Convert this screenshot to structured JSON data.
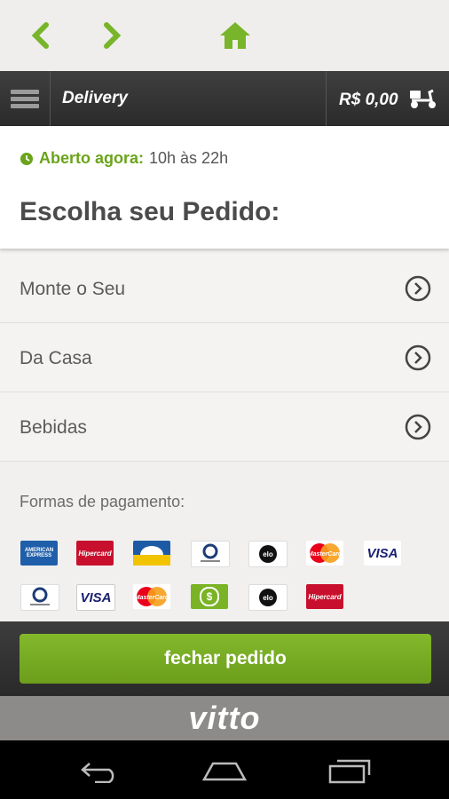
{
  "browser_nav": {
    "back_icon": "chevron-left-icon",
    "forward_icon": "chevron-right-icon",
    "home_icon": "home-icon",
    "accent": "#6aa41a"
  },
  "header": {
    "title": "Delivery",
    "cart_total": "R$ 0,00",
    "menu_icon": "hamburger-menu-icon",
    "cart_icon": "delivery-scooter-icon"
  },
  "status": {
    "open_label": "Aberto agora:",
    "hours": "10h às 22h"
  },
  "page_title": "Escolha seu Pedido:",
  "menu": {
    "items": [
      {
        "label": "Monte o Seu"
      },
      {
        "label": "Da Casa"
      },
      {
        "label": "Bebidas"
      }
    ]
  },
  "payment": {
    "label": "Formas de pagamento:",
    "row1": [
      "americanexpress-card",
      "hipercard-card",
      "banricompras-card",
      "dinersclub-card",
      "elo-card",
      "mastercard-card",
      "visa-card"
    ],
    "row2": [
      "dinersclub-card",
      "visa-card",
      "mastercard-card",
      "cash-card",
      "elo-card",
      "hipercard-card"
    ],
    "text": {
      "hipercard": "Hipercard",
      "visa": "VISA",
      "mastercard": "MasterCard",
      "elo": "elo",
      "amex": "AMERICAN EXPRESS",
      "dollar": "$"
    }
  },
  "footer": {
    "checkout_label": "fechar pedido",
    "brand": "vitto"
  },
  "system_nav": {
    "back": "back-icon",
    "home": "home-icon",
    "recent": "recent-apps-icon"
  }
}
